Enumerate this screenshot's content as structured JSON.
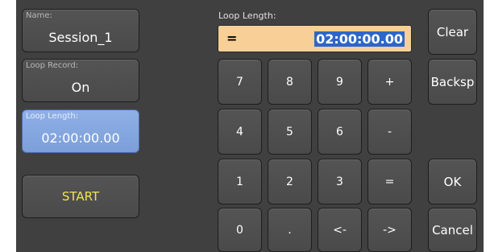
{
  "fields": {
    "name": {
      "caption": "Name:",
      "value": "Session_1"
    },
    "loop_record": {
      "caption": "Loop Record:",
      "value": "On"
    },
    "loop_length": {
      "caption": "Loop Length:",
      "value": "02:00:00.00"
    }
  },
  "start_label": "START",
  "entry": {
    "label": "Loop Length:",
    "operator": "=",
    "value": "02:00:00.00"
  },
  "keypad": {
    "k7": "7",
    "k8": "8",
    "k9": "9",
    "plus": "+",
    "k4": "4",
    "k5": "5",
    "k6": "6",
    "minus": "-",
    "k1": "1",
    "k2": "2",
    "k3": "3",
    "equals": "=",
    "k0": "0",
    "dot": ".",
    "left": "<-",
    "right": "->"
  },
  "side_buttons": {
    "clear": "Clear",
    "backspace": "Backsp",
    "ok": "OK",
    "cancel": "Cancel"
  },
  "colors": {
    "panel_bg": "#404040",
    "entry_bg": "#f7cf97",
    "selected_field": "#8fb0e6",
    "start_text": "#f2e64a",
    "value_highlight": "#2e66c8"
  }
}
